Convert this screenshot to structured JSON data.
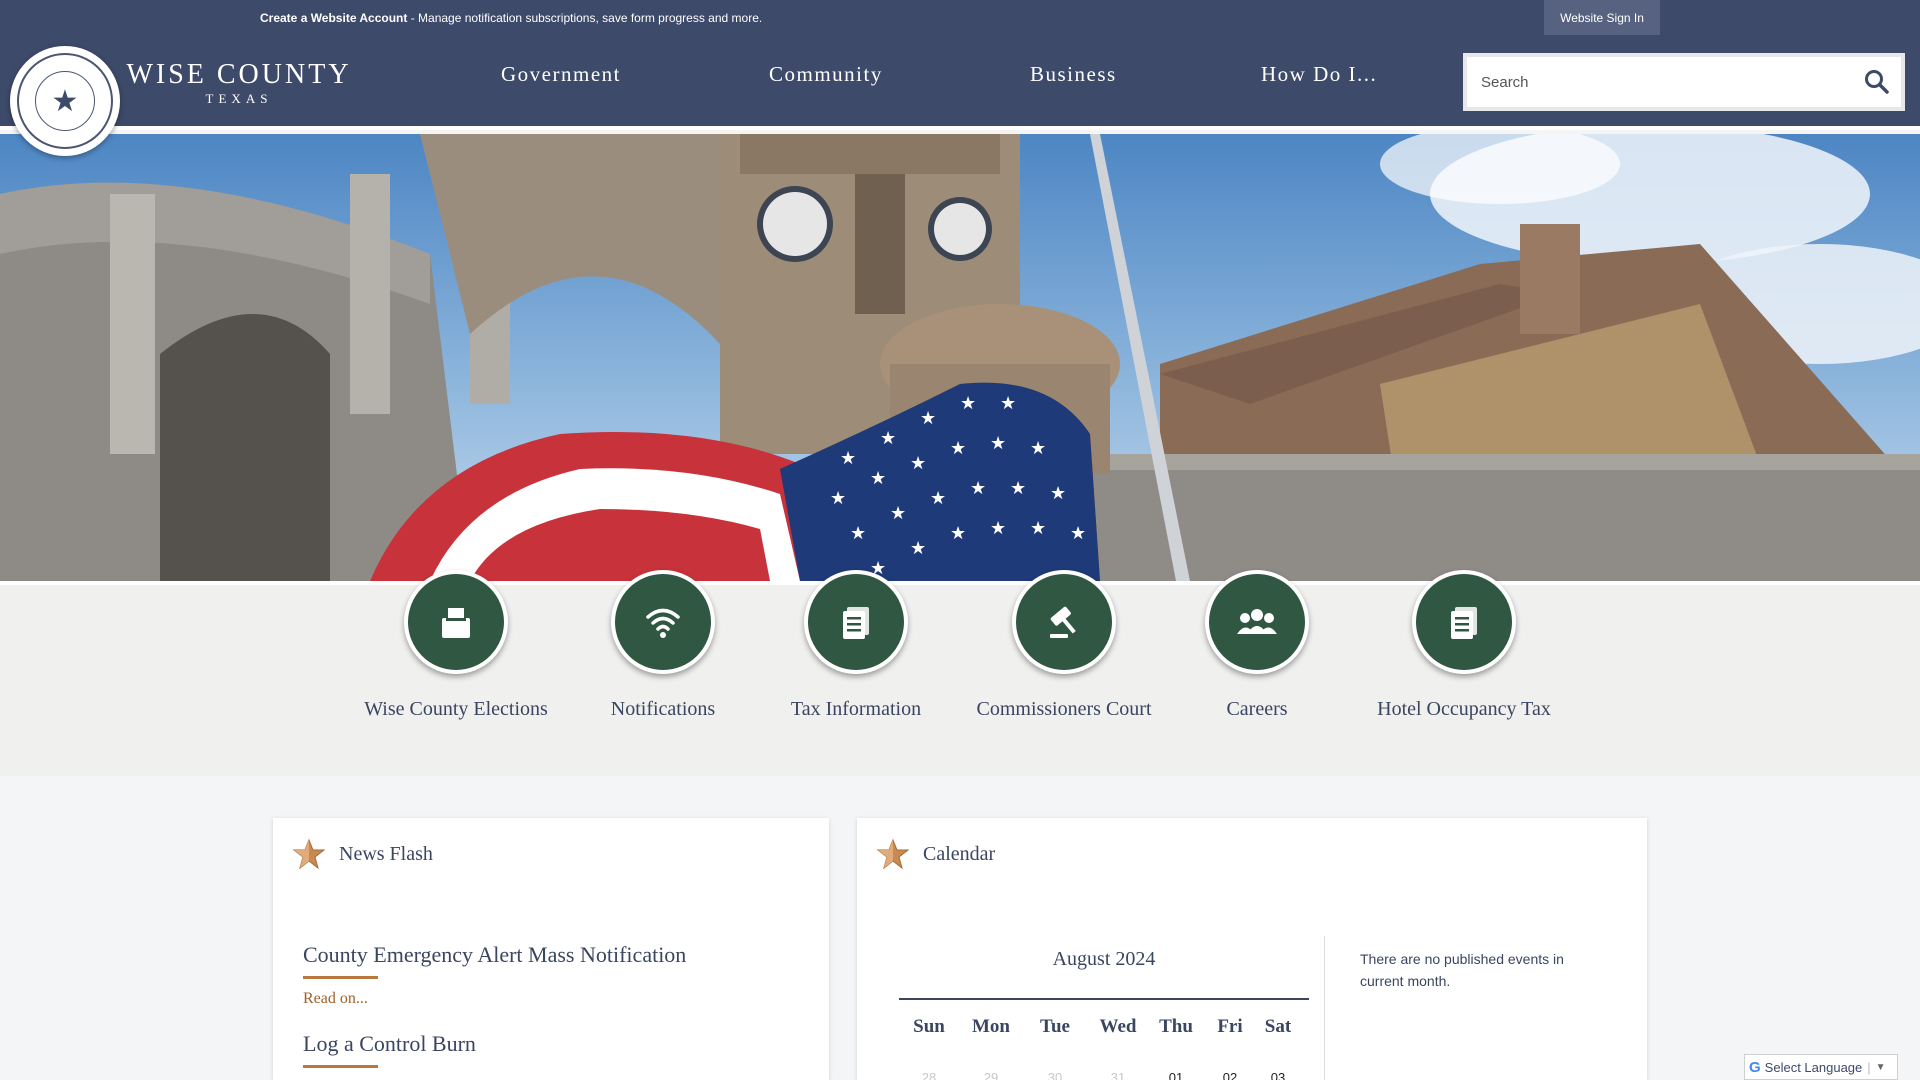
{
  "topbar": {
    "create_account": "Create a Website Account",
    "message": " - Manage notification subscriptions, save form progress and more.",
    "sign_in": "Website Sign In"
  },
  "brand": {
    "name": "WISE COUNTY",
    "state": "TEXAS"
  },
  "nav": [
    {
      "label": "Government"
    },
    {
      "label": "Community"
    },
    {
      "label": "Business"
    },
    {
      "label": "How Do I..."
    }
  ],
  "search": {
    "placeholder": "Search",
    "value": ""
  },
  "quick_links": [
    {
      "label": "Wise County Elections",
      "icon": "ballot-box-icon"
    },
    {
      "label": "Notifications",
      "icon": "wifi-icon"
    },
    {
      "label": "Tax Information",
      "icon": "document-icon"
    },
    {
      "label": "Commissioners Court",
      "icon": "gavel-icon"
    },
    {
      "label": "Careers",
      "icon": "people-icon"
    },
    {
      "label": "Hotel Occupancy Tax",
      "icon": "document-icon"
    }
  ],
  "news": {
    "title": "News Flash",
    "items": [
      {
        "title": "County Emergency Alert Mass Notification",
        "read_on": "Read on..."
      },
      {
        "title": "Log a Control Burn"
      }
    ]
  },
  "calendar": {
    "title": "Calendar",
    "month": "August 2024",
    "day_headers": [
      "Sun",
      "Mon",
      "Tue",
      "Wed",
      "Thu",
      "Fri",
      "Sat"
    ],
    "first_row": [
      "28",
      "29",
      "30",
      "31",
      "01",
      "02",
      "03"
    ],
    "no_events": "There are no published events in current month."
  },
  "language": {
    "label": "Select Language",
    "arrow": "▼"
  },
  "colors": {
    "navy": "#3d4a6a",
    "green": "#2f5741",
    "accent": "#b8783e"
  }
}
